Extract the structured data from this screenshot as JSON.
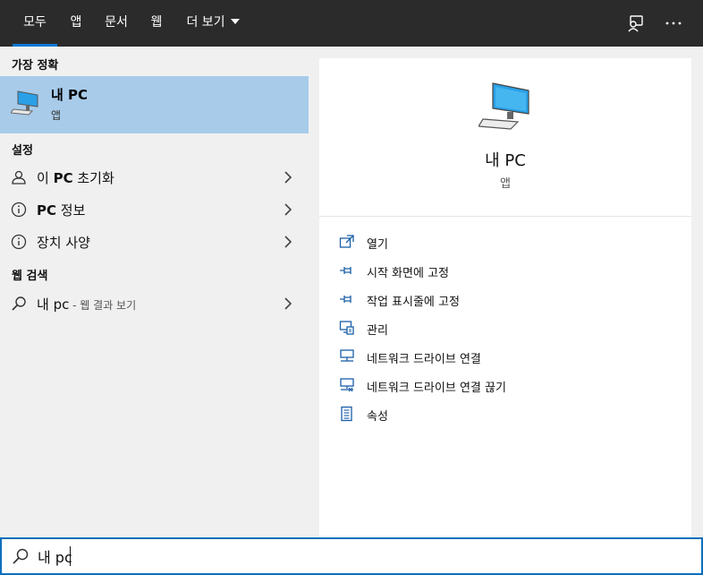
{
  "tabs": [
    {
      "label": "모두",
      "active": true
    },
    {
      "label": "앱"
    },
    {
      "label": "문서"
    },
    {
      "label": "웹"
    },
    {
      "label": "더 보기"
    }
  ],
  "topbar_icons": [
    "feedback-icon",
    "more-options-icon"
  ],
  "left": {
    "best_match_header": "가장 정확",
    "best_match": {
      "name": "내 PC",
      "type": "앱",
      "icon": "computer-icon"
    },
    "settings_header": "설정",
    "settings": [
      {
        "prefix": "이 ",
        "bold": "PC",
        "suffix": " 초기화",
        "icon": "reset-pc-icon"
      },
      {
        "prefix": "",
        "bold": "PC",
        "suffix": " 정보",
        "icon": "info-icon"
      },
      {
        "prefix": "",
        "bold": "",
        "suffix": "장치 사양",
        "icon": "info-icon"
      }
    ],
    "web_header": "웹 검색",
    "web_result": {
      "query": "내 pc",
      "hint": " - 웹 결과 보기",
      "icon": "search-icon"
    }
  },
  "right": {
    "title": "내 PC",
    "subtitle": "앱",
    "actions": [
      {
        "label": "열기",
        "icon": "open-icon"
      },
      {
        "label": "시작 화면에 고정",
        "icon": "pin-icon"
      },
      {
        "label": "작업 표시줄에 고정",
        "icon": "pin-icon"
      },
      {
        "label": "관리",
        "icon": "manage-icon"
      },
      {
        "label": "네트워크 드라이브 연결",
        "icon": "network-drive-icon"
      },
      {
        "label": "네트워크 드라이브 연결 끊기",
        "icon": "network-drive-disconnect-icon"
      },
      {
        "label": "속성",
        "icon": "properties-icon"
      }
    ]
  },
  "search": {
    "value": "내 pc",
    "icon": "search-icon"
  },
  "colors": {
    "accent": "#0a78d4",
    "selected_bg": "#a8cbea",
    "topbar_bg": "#2b2b2b"
  }
}
